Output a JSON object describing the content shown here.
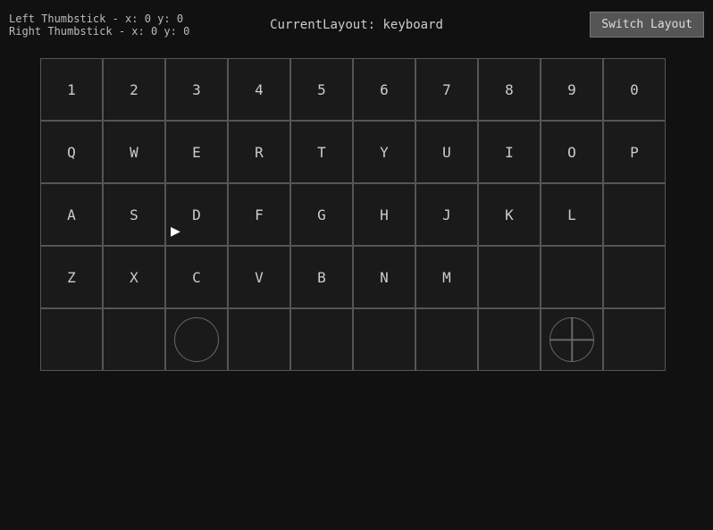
{
  "header": {
    "left_thumbstick": "Left Thumbstick - x: 0 y: 0",
    "right_thumbstick": "Right Thumbstick - x: 0 y: 0",
    "current_layout": "CurrentLayout: keyboard",
    "switch_layout_label": "Switch Layout"
  },
  "keyboard": {
    "rows": [
      [
        "1",
        "2",
        "3",
        "4",
        "5",
        "6",
        "7",
        "8",
        "9",
        "0"
      ],
      [
        "Q",
        "W",
        "E",
        "R",
        "T",
        "Y",
        "U",
        "I",
        "O",
        "P"
      ],
      [
        "A",
        "S",
        "D",
        "F",
        "G",
        "H",
        "J",
        "K",
        "L",
        ""
      ],
      [
        "Z",
        "X",
        "C",
        "V",
        "B",
        "N",
        "M",
        "",
        "",
        ""
      ],
      [
        "",
        "",
        "",
        "",
        "",
        "",
        "",
        "",
        "",
        ""
      ]
    ]
  }
}
